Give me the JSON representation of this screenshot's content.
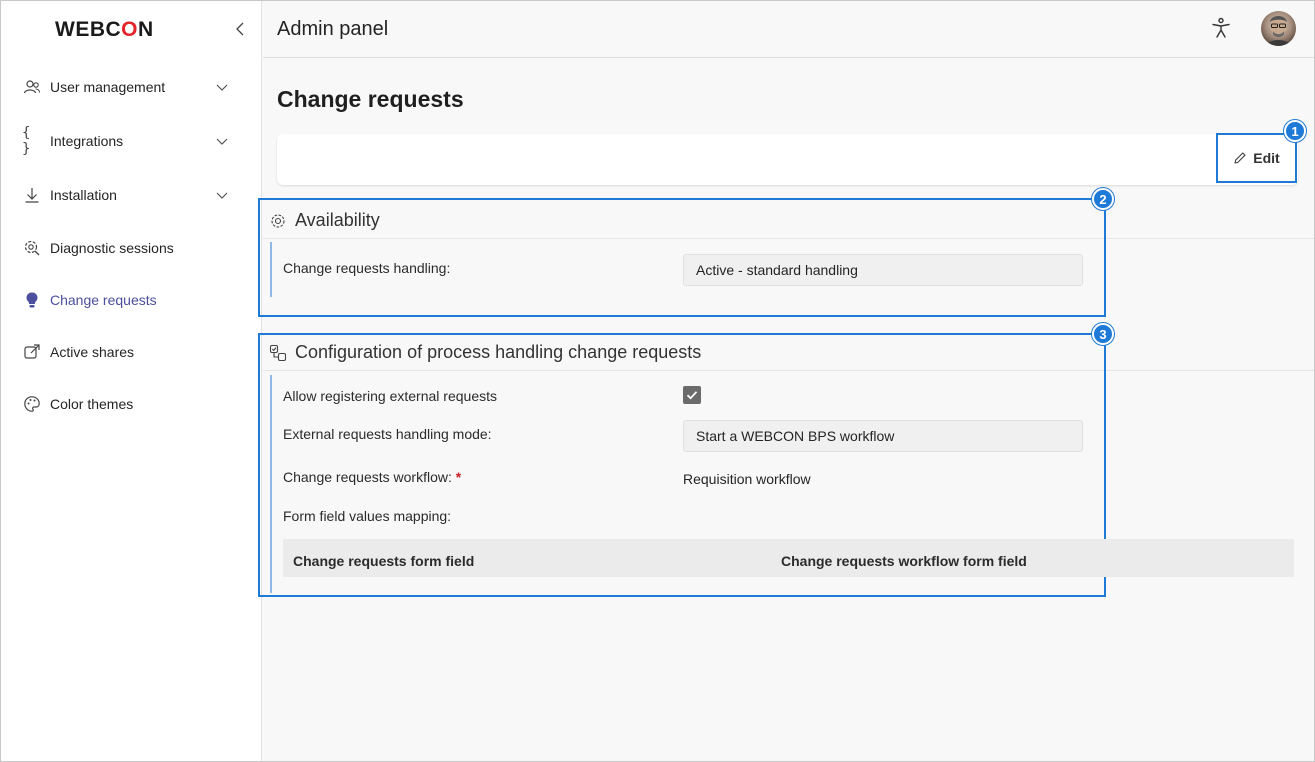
{
  "app": {
    "logo_text_a": "WEBC",
    "logo_text_o": "O",
    "logo_text_b": "N",
    "brand_accent": "#e3242b",
    "highlight_color": "#1e7ad6"
  },
  "sidebar": {
    "collapse_icon": "chevron-left-icon",
    "items": [
      {
        "label": "User management",
        "icon": "users-icon",
        "expandable": true,
        "active": false
      },
      {
        "label": "Integrations",
        "icon": "braces-icon",
        "expandable": true,
        "active": false
      },
      {
        "label": "Installation",
        "icon": "download-icon",
        "expandable": true,
        "active": false
      },
      {
        "label": "Diagnostic sessions",
        "icon": "gear-search-icon",
        "expandable": false,
        "active": false
      },
      {
        "label": "Change requests",
        "icon": "lightbulb-icon",
        "expandable": false,
        "active": true
      },
      {
        "label": "Active shares",
        "icon": "share-icon",
        "expandable": false,
        "active": false
      },
      {
        "label": "Color themes",
        "icon": "palette-icon",
        "expandable": false,
        "active": false
      }
    ]
  },
  "header": {
    "title": "Admin panel",
    "accessibility_icon": "accessibility-icon",
    "avatar_icon": "user-avatar"
  },
  "main": {
    "page_title": "Change requests",
    "toolbar": {
      "edit_label": "Edit",
      "edit_icon": "pencil-icon",
      "badge": "1"
    },
    "availability": {
      "title": "Availability",
      "icon": "gear-icon",
      "badge": "2",
      "fields": {
        "handling_label": "Change requests handling:",
        "handling_value": "Active - standard handling"
      }
    },
    "configuration": {
      "title": "Configuration of process handling change requests",
      "icon": "process-icon",
      "badge": "3",
      "fields": {
        "allow_external_label": "Allow registering external requests",
        "allow_external_checked": true,
        "external_mode_label": "External requests handling mode:",
        "external_mode_value": "Start a WEBCON BPS workflow",
        "workflow_label": "Change requests workflow:",
        "workflow_required_mark": "*",
        "workflow_value": "Requisition workflow",
        "mapping_label": "Form field values mapping:"
      },
      "mapping_table": {
        "columns": [
          "Change requests form field",
          "Change requests workflow form field"
        ]
      }
    }
  }
}
